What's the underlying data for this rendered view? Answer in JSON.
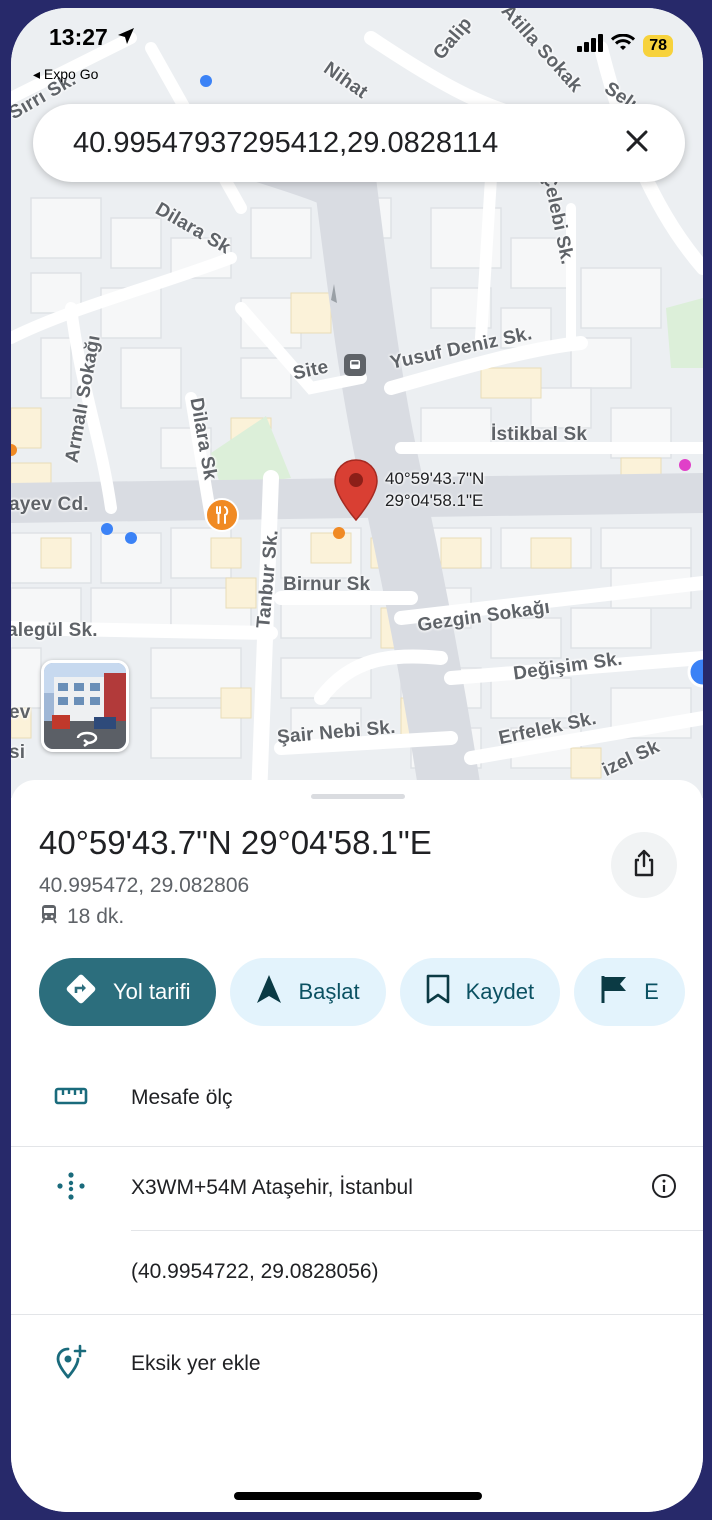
{
  "status_bar": {
    "time": "13:27",
    "back_app": "◂ Expo Go",
    "battery": "78"
  },
  "search": {
    "query": "40.99547937295412,29.0828114"
  },
  "map": {
    "streets": [
      "Galip",
      "Atilla Sokak",
      "Selı",
      "Nihat",
      "Sırrı Sk.",
      "Dilara Sk",
      "Çelebi Sk.",
      "Armalı Sokağı",
      "Dilara Sk",
      "Site",
      "Yusuf Deniz Sk.",
      "İstikbal Sk",
      "ayev Cd.",
      "Tanbur Sk.",
      "Birnur Sk",
      "Gezgin Sokağı",
      "alegül Sk.",
      "Değişim Sk.",
      "Erfelek Sk.",
      "Şair Nebi Sk.",
      "izel Sk",
      "ev",
      "si"
    ],
    "pin_label_lat": "40°59'43.7\"N",
    "pin_label_lng": "29°04'58.1\"E"
  },
  "sheet": {
    "title": "40°59'43.7\"N 29°04'58.1\"E",
    "coords": "40.995472, 29.082806",
    "transit_time": "18 dk.",
    "chips": [
      {
        "label": "Yol tarifi",
        "icon": "directions-icon"
      },
      {
        "label": "Başlat",
        "icon": "navigation-arrow-icon"
      },
      {
        "label": "Kaydet",
        "icon": "bookmark-icon"
      },
      {
        "label": "E",
        "icon": "flag-icon"
      }
    ],
    "rows": [
      {
        "label": "Mesafe ölç",
        "icon": "ruler-icon"
      },
      {
        "label": "X3WM+54M Ataşehir, İstanbul",
        "icon": "plus-code-icon"
      },
      {
        "label": "(40.9954722, 29.0828056)"
      },
      {
        "label": "Eksik yer ekle",
        "icon": "add-place-icon"
      }
    ]
  },
  "colors": {
    "background": "#27296a",
    "primary_chip": "#2c6e7d",
    "secondary_chip": "#e3f3fc",
    "pin": "#d93f33",
    "icon_teal": "#1a6b7c"
  }
}
